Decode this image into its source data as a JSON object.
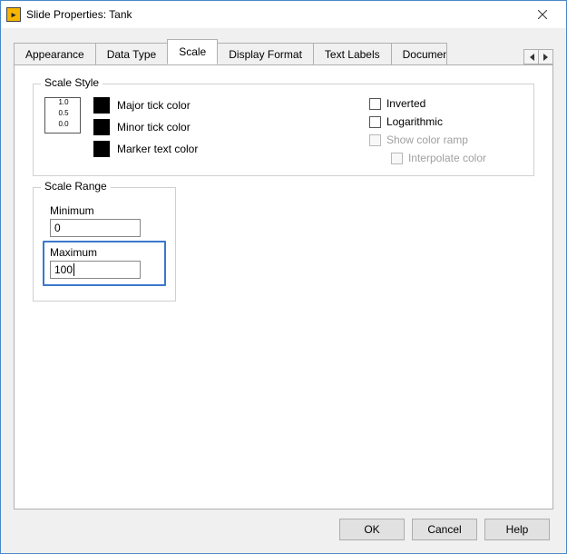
{
  "window": {
    "title": "Slide Properties: Tank"
  },
  "tabs": {
    "appearance": "Appearance",
    "data_type": "Data Type",
    "scale": "Scale",
    "display_format": "Display Format",
    "text_labels": "Text Labels",
    "documentation": "Documen"
  },
  "scale_style": {
    "legend": "Scale Style",
    "preview_values": [
      "1.0",
      "0.5",
      "0.0"
    ],
    "major_tick_label": "Major tick color",
    "minor_tick_label": "Minor tick color",
    "marker_text_label": "Marker text color",
    "inverted_label": "Inverted",
    "logarithmic_label": "Logarithmic",
    "show_color_ramp_label": "Show color ramp",
    "interpolate_color_label": "Interpolate color",
    "colors": {
      "major": "#000000",
      "minor": "#000000",
      "marker": "#000000"
    }
  },
  "scale_range": {
    "legend": "Scale Range",
    "minimum_label": "Minimum",
    "minimum_value": "0",
    "maximum_label": "Maximum",
    "maximum_value": "100"
  },
  "buttons": {
    "ok": "OK",
    "cancel": "Cancel",
    "help": "Help"
  }
}
